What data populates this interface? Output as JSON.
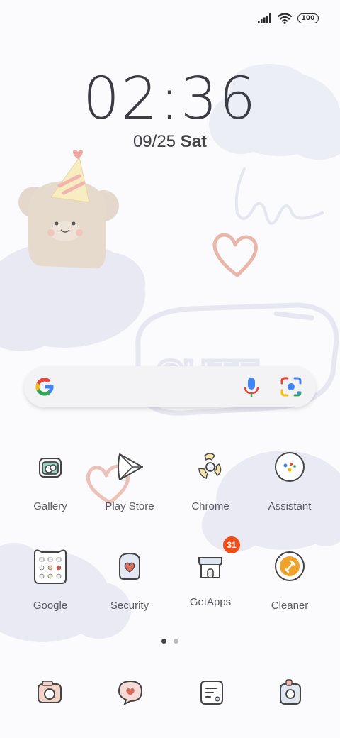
{
  "status_bar": {
    "battery": "100"
  },
  "clock": {
    "hours": "02",
    "separator": ":",
    "minutes": "36"
  },
  "date": {
    "numeric": "09/25",
    "day": "Sat"
  },
  "wallpaper": {
    "text": "CUTE"
  },
  "search": {
    "placeholder": ""
  },
  "apps_row1": [
    {
      "label": "Gallery"
    },
    {
      "label": "Play Store"
    },
    {
      "label": "Chrome"
    },
    {
      "label": "Assistant"
    }
  ],
  "apps_row2": [
    {
      "label": "Google"
    },
    {
      "label": "Security"
    },
    {
      "label": "GetApps",
      "badge": "31"
    },
    {
      "label": "Cleaner"
    }
  ],
  "pager": {
    "pages": 2,
    "current": 1
  },
  "colors": {
    "cloud": "#e8e9f2",
    "heart": "#e8b7aa",
    "bear": "#e4d8cc",
    "badge": "#f04d1a",
    "cleaner_orange": "#f0a32a"
  }
}
